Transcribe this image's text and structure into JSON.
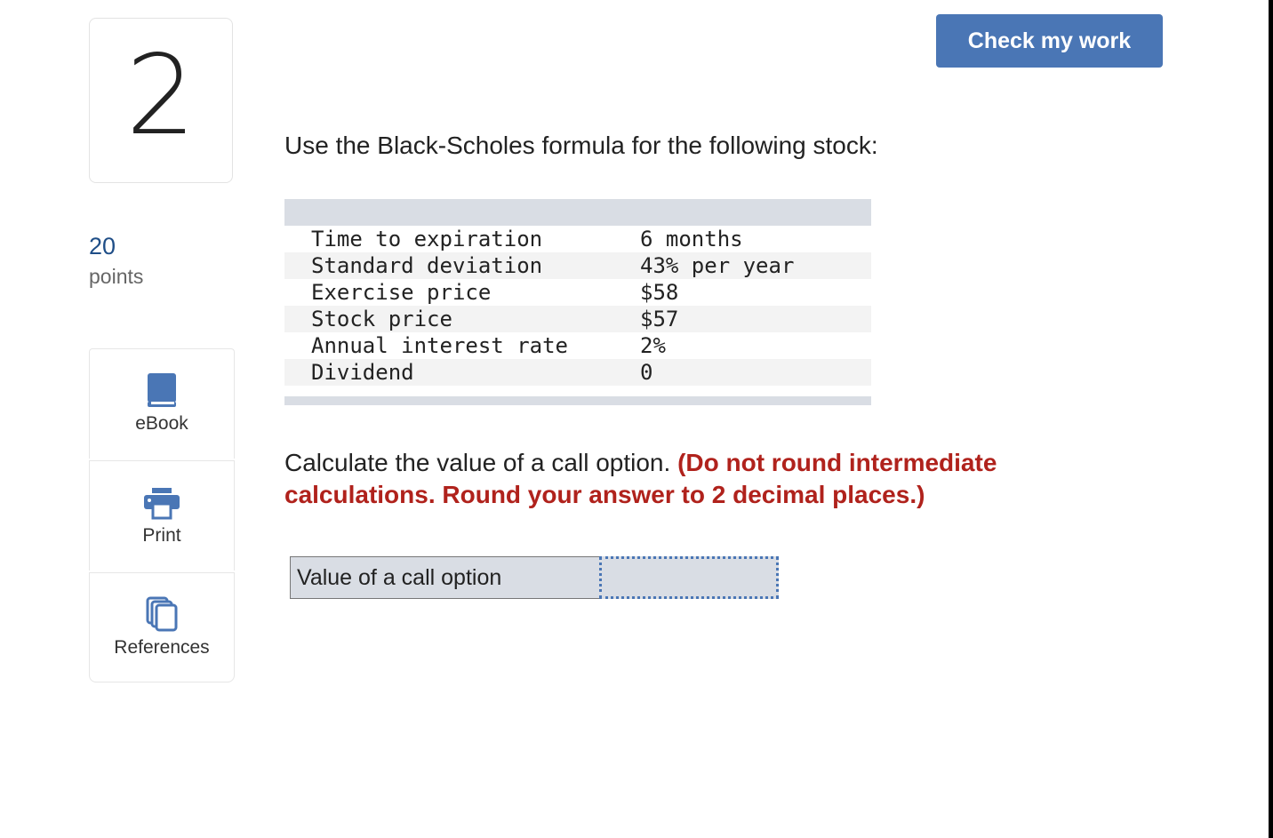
{
  "question": {
    "number": "2",
    "points_value": "20",
    "points_label": "points",
    "prompt": "Use the Black-Scholes formula for the following stock:",
    "instruction_plain": "Calculate the value of a call option.",
    "instruction_red": "(Do not round intermediate calculations. Round your answer to 2 decimal places.)"
  },
  "header": {
    "check_label": "Check my work"
  },
  "tools": {
    "ebook_label": "eBook",
    "print_label": "Print",
    "references_label": "References"
  },
  "table": {
    "rows": [
      {
        "label": "Time to expiration",
        "value": "6 months"
      },
      {
        "label": "Standard deviation",
        "value": "43% per year"
      },
      {
        "label": "Exercise price",
        "value": "$58"
      },
      {
        "label": "Stock price",
        "value": "$57"
      },
      {
        "label": "Annual interest rate",
        "value": "2%"
      },
      {
        "label": "Dividend",
        "value": "0"
      }
    ]
  },
  "answer": {
    "label": "Value of a call option",
    "value": ""
  },
  "colors": {
    "accent": "#4a76b5",
    "instruction_red": "#b0221c",
    "points_blue": "#1f4e87",
    "table_band": "#d9dde4"
  }
}
